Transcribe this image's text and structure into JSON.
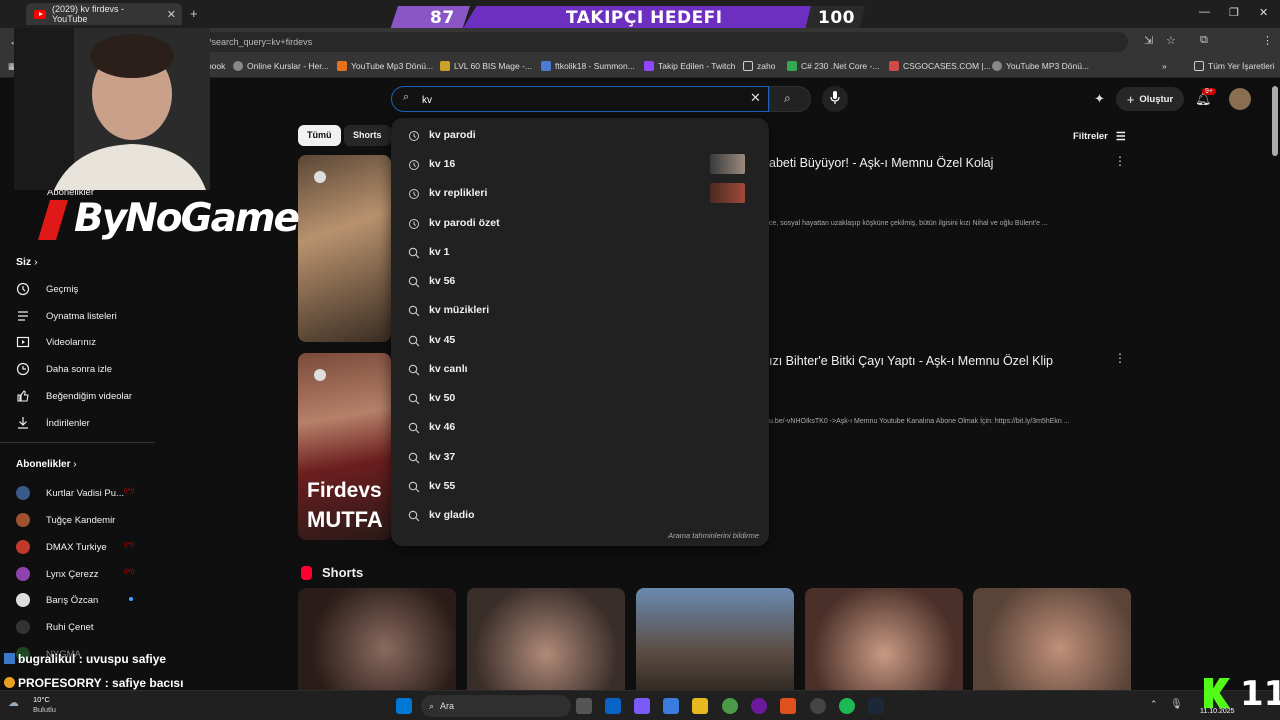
{
  "browser": {
    "tab_title": "(2029) kv firdevs - YouTube",
    "new_tab": "+",
    "url": "be.com/results?search_query=kv+firdevs",
    "bookmarks": [
      {
        "label": "Facebook",
        "color": "#1877f2"
      },
      {
        "label": "Online Kurslar - Her...",
        "color": "#888888"
      },
      {
        "label": "YouTube Mp3 Dönü...",
        "color": "#e8711c"
      },
      {
        "label": "LVL 60 BIS Mage -...",
        "color": "#c9a227"
      },
      {
        "label": "ftkolik18 - Summon...",
        "color": "#4a7bd0"
      },
      {
        "label": "Takip Edilen - Twitch",
        "color": "#9146ff"
      },
      {
        "label": "zaho",
        "color": "#888888"
      },
      {
        "label": "C# 230 .Net Core -...",
        "color": "#34a853"
      },
      {
        "label": "CSGOCASES.COM |...",
        "color": "#d04a4a"
      },
      {
        "label": "YouTube MP3 Dönü...",
        "color": "#888888"
      }
    ],
    "all_bookmarks": "Tüm Yer İşaretleri"
  },
  "banner": {
    "left_value": "87",
    "title": "TAKIPÇI HEDEFI",
    "right_value": "100"
  },
  "youtube": {
    "search_value": "kv",
    "create_label": "Oluştur",
    "notification_count": "9+",
    "filters_label": "Filtreler",
    "chips": [
      "Tümü",
      "Shorts"
    ],
    "shorts_heading": "Shorts"
  },
  "sidebar": {
    "partial_item": "Abonelikler",
    "you_heading": "Siz",
    "you_items": [
      {
        "label": "Geçmiş",
        "icon": "history-icon"
      },
      {
        "label": "Oynatma listeleri",
        "icon": "playlist-icon"
      },
      {
        "label": "Videolarınız",
        "icon": "your-videos-icon"
      },
      {
        "label": "Daha sonra izle",
        "icon": "watch-later-icon"
      },
      {
        "label": "Beğendiğim videolar",
        "icon": "thumbs-up-icon"
      },
      {
        "label": "İndirilenler",
        "icon": "download-icon"
      }
    ],
    "subs_heading": "Abonelikler",
    "subs": [
      {
        "label": "Kurtlar Vadisi Pu...",
        "color": "#3a5a8a",
        "live": true
      },
      {
        "label": "Tuğçe Kandemir",
        "color": "#a0522d",
        "live": false
      },
      {
        "label": "DMAX Turkiye",
        "color": "#c0392b",
        "live": true
      },
      {
        "label": "Lynx Çerezz",
        "color": "#8e44ad",
        "live": true
      },
      {
        "label": "Barış Özcan",
        "color": "#dddddd",
        "live": false,
        "dot": true
      },
      {
        "label": "Ruhi Çenet",
        "color": "#333333",
        "live": false
      },
      {
        "label": "NYGMA",
        "color": "#2e7d32",
        "live": false
      }
    ]
  },
  "results": [
    {
      "title": "abeti Büyüyor! - Aşk-ı Memnu Özel Kolaj",
      "desc": "ce, sosyal hayattan uzaklaşıp köşküne çekilmiş, bütün ilgisini kızı Nihal ve oğlu Bülent'e ..."
    },
    {
      "title": "ızı Bihter'e Bitki Çayı Yaptı - Aşk-ı Memnu Özel Klip",
      "desc": "u.be/-vNHOIksTK0 ->Aşk-ı Memnu Youtube Kanalına Abone Olmak İçin: https://bit.ly/3m5hEkn ...",
      "thumb_text_1": "Firdevs",
      "thumb_text_2": "MUTFA"
    }
  ],
  "suggestions": [
    {
      "text": "kv parodi",
      "type": "history"
    },
    {
      "text": "kv 16",
      "type": "history",
      "thumb": "#6b5a4e"
    },
    {
      "text": "kv replikleri",
      "type": "history",
      "thumb": "#8a3a2a"
    },
    {
      "text": "kv parodi özet",
      "type": "history"
    },
    {
      "text": "kv 1",
      "type": "search"
    },
    {
      "text": "kv 56",
      "type": "search"
    },
    {
      "text": "kv müzikleri",
      "type": "search"
    },
    {
      "text": "kv 45",
      "type": "search"
    },
    {
      "text": "kv canlı",
      "type": "search"
    },
    {
      "text": "kv 50",
      "type": "search"
    },
    {
      "text": "kv 46",
      "type": "search"
    },
    {
      "text": "kv 37",
      "type": "search"
    },
    {
      "text": "kv 55",
      "type": "search"
    },
    {
      "text": "kv gladio",
      "type": "search"
    }
  ],
  "suggestions_report": "Arama tahminlerini bildirme",
  "stream": {
    "logo_text": "ByNoGame",
    "chat": [
      {
        "user": "bugralikul",
        "message": ": uvuspu safiye",
        "user_color": "#ffffff"
      },
      {
        "user": "PROFESORRY",
        "message": ": safiye bacısı",
        "user_color": "#ffffff"
      }
    ],
    "counter": "11"
  },
  "taskbar": {
    "weather_temp": "10°C",
    "weather_desc": "Bulutlu",
    "search_label": "Ara",
    "date": "11.10.2025"
  }
}
